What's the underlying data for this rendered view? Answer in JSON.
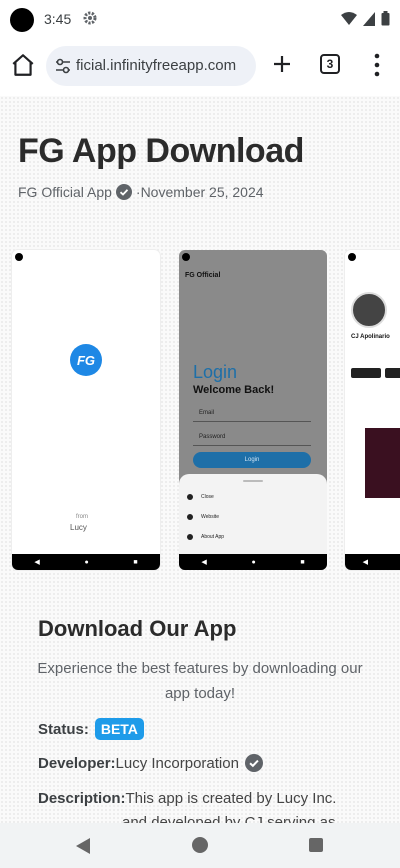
{
  "status_bar": {
    "time": "3:45"
  },
  "browser": {
    "url": "ficial.infinityfreeapp.com",
    "tab_count": "3"
  },
  "article": {
    "title": "FG App Download",
    "author": "FG Official App",
    "date": "·November 25, 2024"
  },
  "screenshots": {
    "splash": {
      "from_label": "from",
      "brand": "Lucy",
      "logo_text": "FG"
    },
    "login": {
      "header": "FG Official",
      "title": "Login",
      "welcome": "Welcome Back!",
      "email_placeholder": "Email",
      "password_placeholder": "Password",
      "button": "Login",
      "menu": [
        "Close",
        "Website",
        "About App"
      ]
    },
    "profile": {
      "name": "CJ Apolinario"
    }
  },
  "download": {
    "title": "Download Our App",
    "subtitle": "Experience the best features by downloading our app today!",
    "status_label": "Status:",
    "status_value": "BETA",
    "developer_label": "Developer:",
    "developer_value": "Lucy Incorporation",
    "description_label": "Description:",
    "description_value": "This app is created by Lucy Inc.",
    "description_more": "and developed by CJ serving as"
  },
  "colors": {
    "accent": "#1e9be9",
    "login_blue": "#1e6fa8"
  }
}
